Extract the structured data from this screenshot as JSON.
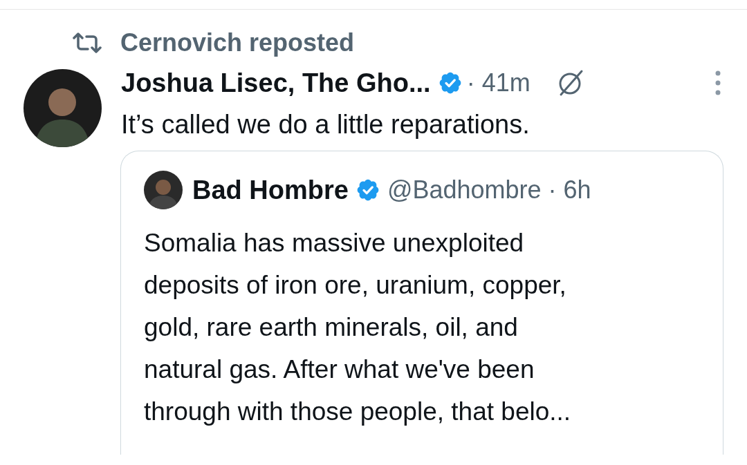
{
  "repost": {
    "label": "Cernovich reposted"
  },
  "post": {
    "author": "Joshua Lisec, The Gho...",
    "verified": true,
    "time": "· 41m",
    "text": "It’s called we do a little reparations.",
    "quote": {
      "author": "Bad Hombre",
      "verified": true,
      "handle": "@Badhombre · 6h",
      "text": "Somalia has massive unexploited\ndeposits of iron ore, uranium, copper,\ngold, rare earth minerals, oil, and\nnatural gas. After what we've been\nthrough with those people, that belo..."
    }
  }
}
